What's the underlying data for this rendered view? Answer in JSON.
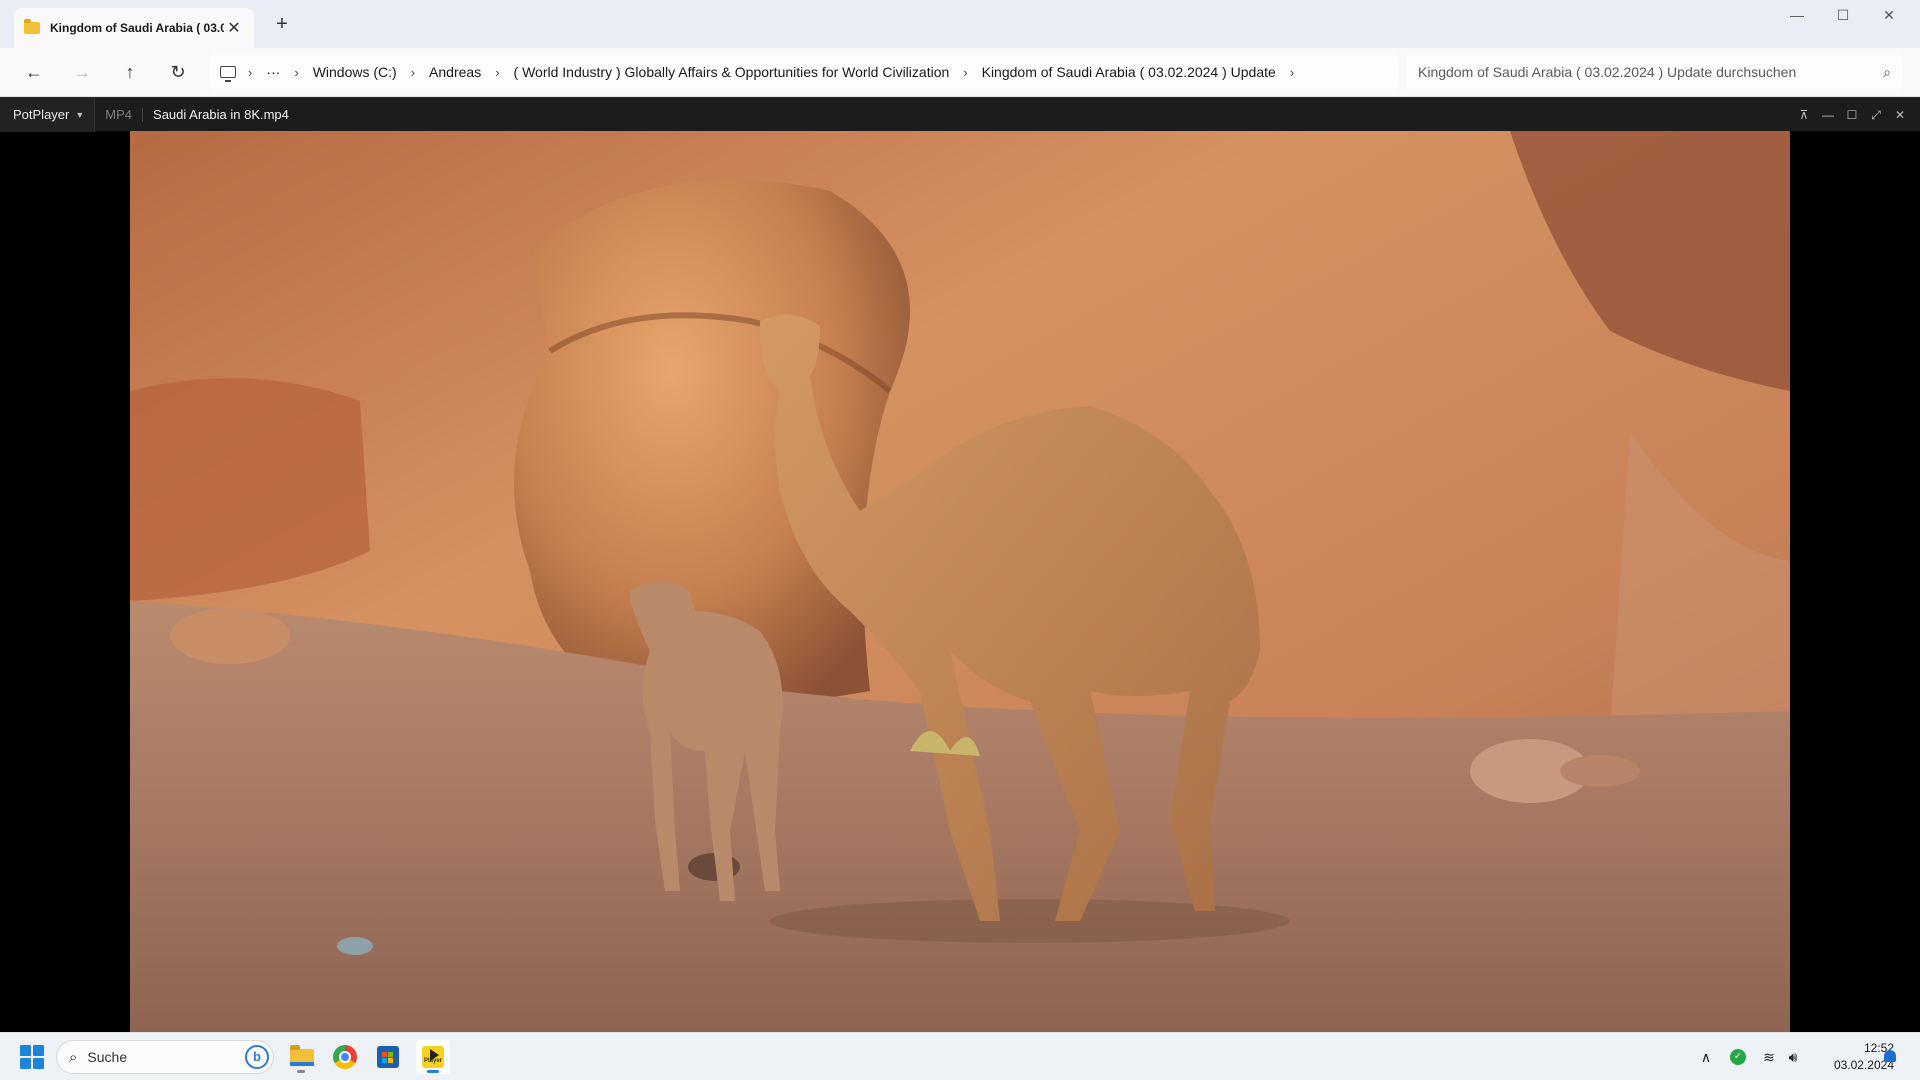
{
  "explorer": {
    "tab_title": "Kingdom of Saudi Arabia ( 03.0",
    "breadcrumbs": [
      "Windows (C:)",
      "Andreas",
      "( World Industry ) Globally Affairs & Opportunities for World Civilization",
      "Kingdom of Saudi Arabia ( 03.02.2024 ) Update"
    ],
    "search_placeholder": "Kingdom of Saudi Arabia ( 03.02.2024 ) Update durchsuchen"
  },
  "player": {
    "menu_label": "PotPlayer",
    "format": "MP4",
    "filename": "Saudi Arabia in 8K.mp4"
  },
  "taskbar": {
    "search_label": "Suche",
    "time": "12:52",
    "date": "03.02.2024"
  },
  "icons": {
    "folder": "folder-icon",
    "back": "arrow-left-icon",
    "forward": "arrow-right-icon",
    "up": "arrow-up-icon",
    "refresh": "refresh-icon",
    "search": "search-icon"
  },
  "colors": {
    "accent": "#1b83d9",
    "player_bar": "#1c1c1c"
  }
}
